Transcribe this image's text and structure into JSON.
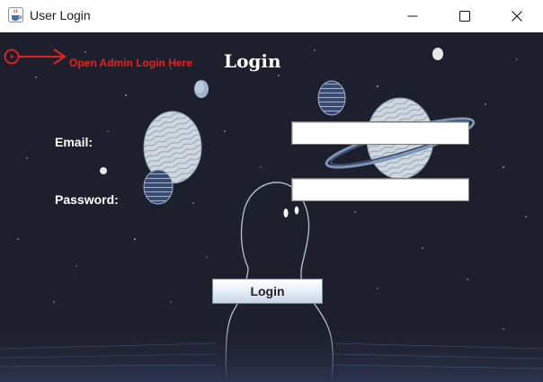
{
  "window": {
    "title": "User Login",
    "icon": "java-cup-icon",
    "controls": [
      "minimize-icon",
      "maximize-icon",
      "close-icon"
    ]
  },
  "admin_link": {
    "label": "Open Admin Login Here",
    "icon": "radio-dot-icon",
    "color": "#e52222"
  },
  "form": {
    "title": "Login",
    "email_label": "Email:",
    "email_value": "",
    "password_label": "Password:",
    "password_value": "",
    "submit_label": "Login"
  },
  "theme": {
    "background": "#1e1f2c",
    "text": "#ffffff"
  }
}
